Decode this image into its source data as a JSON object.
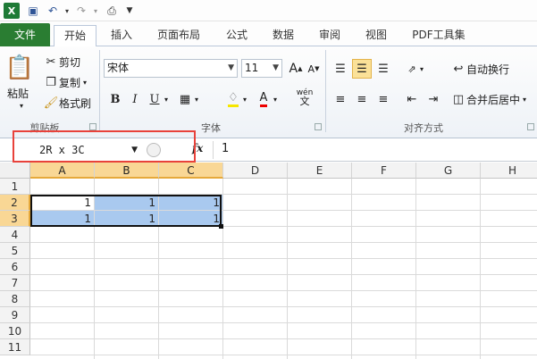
{
  "ribbon_tabs": [
    "文件",
    "开始",
    "插入",
    "页面布局",
    "公式",
    "数据",
    "审阅",
    "视图",
    "PDF工具集"
  ],
  "clipboard": {
    "paste": "粘贴",
    "cut": "剪切",
    "copy": "复制",
    "format_painter": "格式刷",
    "group": "剪贴板"
  },
  "font": {
    "name": "宋体",
    "size": "11",
    "group": "字体",
    "grow": "A",
    "shrink": "A",
    "bold": "B",
    "italic": "I",
    "underline": "U",
    "font_color": "A",
    "phonetic": "wén"
  },
  "alignment": {
    "wrap": "自动换行",
    "merge": "合并后居中",
    "group": "对齐方式"
  },
  "formula_bar": {
    "name_box": "2R x 3C",
    "fx": "fx",
    "value": "1"
  },
  "columns": [
    "A",
    "B",
    "C",
    "D",
    "E",
    "F",
    "G",
    "H"
  ],
  "rows": [
    "1",
    "2",
    "3",
    "4",
    "5",
    "6",
    "7",
    "8",
    "9",
    "10",
    "11"
  ],
  "cells": {
    "A2": "1",
    "B2": "1",
    "C2": "1",
    "A3": "1",
    "B3": "1",
    "C3": "1"
  },
  "colors": {
    "file_tab": "#2a7d32",
    "selection": "#a9c9ef",
    "header_selected": "#f9d795",
    "annotation": "#e8423b"
  }
}
